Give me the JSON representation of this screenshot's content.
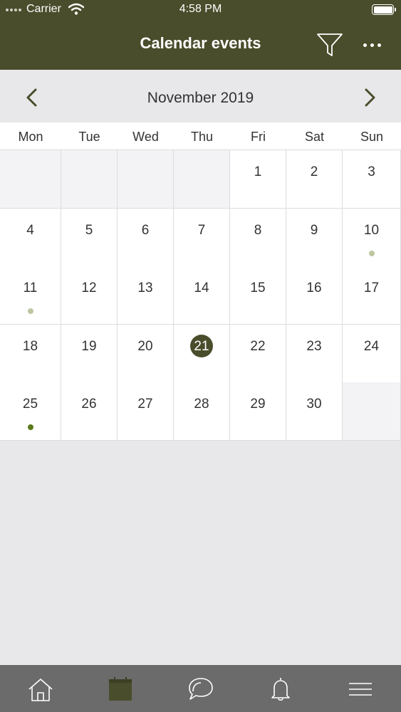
{
  "status": {
    "carrier": "Carrier",
    "time": "4:58 PM"
  },
  "header": {
    "title": "Calendar events"
  },
  "month": {
    "label": "November 2019"
  },
  "weekdays": [
    "Mon",
    "Tue",
    "Wed",
    "Thu",
    "Fri",
    "Sat",
    "Sun"
  ],
  "days": [
    {
      "num": ""
    },
    {
      "num": ""
    },
    {
      "num": ""
    },
    {
      "num": ""
    },
    {
      "num": "1"
    },
    {
      "num": "2"
    },
    {
      "num": "3"
    },
    {
      "num": "4"
    },
    {
      "num": "5"
    },
    {
      "num": "6"
    },
    {
      "num": "7"
    },
    {
      "num": "8"
    },
    {
      "num": "9"
    },
    {
      "num": "10",
      "dot": "#bcc7a0"
    },
    {
      "num": "11",
      "dot": "#bcc7a0"
    },
    {
      "num": "12"
    },
    {
      "num": "13"
    },
    {
      "num": "14"
    },
    {
      "num": "15"
    },
    {
      "num": "16"
    },
    {
      "num": "17"
    },
    {
      "num": "18"
    },
    {
      "num": "19"
    },
    {
      "num": "20"
    },
    {
      "num": "21",
      "today": true
    },
    {
      "num": "22"
    },
    {
      "num": "23"
    },
    {
      "num": "24"
    },
    {
      "num": "25",
      "dot": "#5b7a1a"
    },
    {
      "num": "26"
    },
    {
      "num": "27"
    },
    {
      "num": "28"
    },
    {
      "num": "29"
    },
    {
      "num": "30"
    },
    {
      "num": ""
    }
  ],
  "tabs": [
    {
      "icon": "home-icon"
    },
    {
      "icon": "calendar-icon",
      "active": true
    },
    {
      "icon": "chat-icon"
    },
    {
      "icon": "bell-icon"
    },
    {
      "icon": "menu-icon"
    }
  ],
  "colors": {
    "header": "#4a4d2b",
    "accent": "#4a4d2b",
    "tabbar": "#6b6b6b"
  }
}
